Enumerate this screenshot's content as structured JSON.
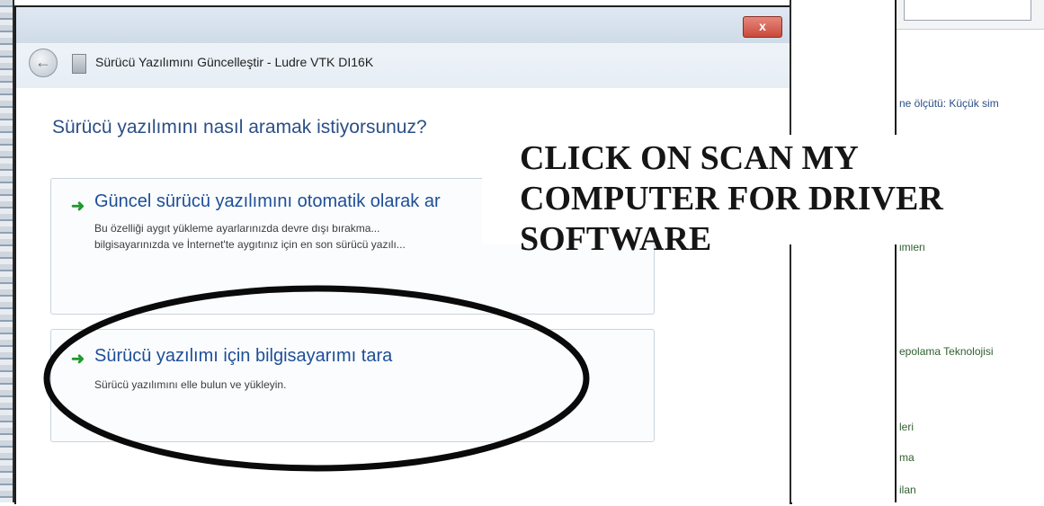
{
  "dialog": {
    "window_title": "Sürücü Yazılımını Güncelleştir - Ludre VTK DI16K",
    "close_label": "x",
    "question": "Sürücü yazılımını nasıl aramak istiyorsunuz?",
    "options": [
      {
        "title": "Güncel sürücü yazılımını otomatik olarak ar",
        "desc_line1": "Bu özelliği aygıt yükleme ayarlarınızda devre dışı bırakma...",
        "desc_line2": "bilgisayarınızda ve İnternet'te aygıtınız için en son sürücü yazılı..."
      },
      {
        "title": "Sürücü yazılımı için bilgisayarımı tara",
        "desc": "Sürücü yazılımını elle bulun ve yükleyin."
      }
    ]
  },
  "background_window": {
    "toolbar_text": "ne ölçütü:   Küçük sim",
    "items": [
      "imleri",
      "epolama Teknolojisi",
      "leri",
      "ma",
      "ilan"
    ]
  },
  "overlay": {
    "instruction": "CLICK ON SCAN MY\nCOMPUTER FOR DRIVER\nSOFTWARE"
  },
  "colors": {
    "option_title": "#1d4e97",
    "arrow": "#1f9a2d",
    "close_button": "#c94a3a"
  },
  "icons": [
    "back-arrow-icon",
    "driver-device-icon",
    "green-arrow-icon",
    "close-icon"
  ]
}
